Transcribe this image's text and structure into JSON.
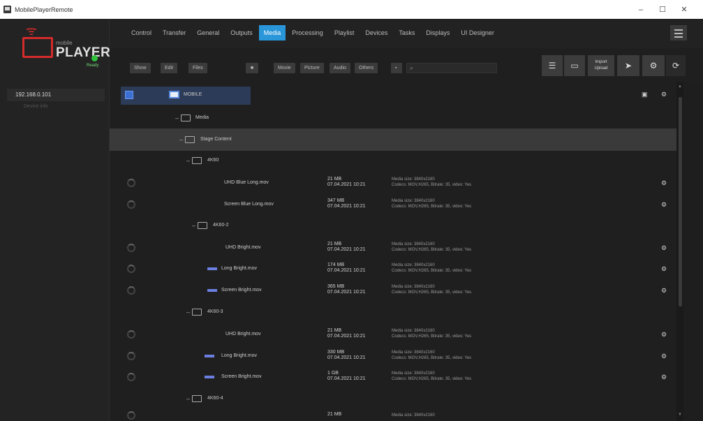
{
  "window": {
    "title": "MobilePlayerRemote",
    "minimize": "–",
    "maximize": "☐",
    "close": "✕"
  },
  "logo": {
    "small_text": "mobile",
    "big_text": "PLAYER"
  },
  "sidebar": {
    "status_label": "Ready",
    "device_ip": "192.168.0.101",
    "device_sub": "Device info"
  },
  "tabs": [
    {
      "label": "Control",
      "active": false
    },
    {
      "label": "Transfer",
      "active": false
    },
    {
      "label": "General",
      "active": false
    },
    {
      "label": "Outputs",
      "active": false
    },
    {
      "label": "Media",
      "active": true
    },
    {
      "label": "Processing",
      "active": false
    },
    {
      "label": "Playlist",
      "active": false
    },
    {
      "label": "Devices",
      "active": false
    },
    {
      "label": "Tasks",
      "active": false
    },
    {
      "label": "Displays",
      "active": false
    },
    {
      "label": "UI Designer",
      "active": false
    }
  ],
  "toolbar": {
    "filters": [
      "Show",
      "Edit",
      "Files"
    ],
    "types": [
      "Movie",
      "Picture",
      "Audio",
      "Others"
    ],
    "search_placeholder": "",
    "import_label": "Import",
    "upload_label": "Upload"
  },
  "tree": {
    "root": "MOBILE",
    "media_folder": "Media",
    "stage_folder": "Stage Content",
    "groups": [
      {
        "folder": "4K60",
        "items": [
          {
            "name": "UHD Blue Long.mov",
            "size": "21 MB",
            "date": "07.04.2021 10:21",
            "meta1": "Media size: 3840x2160",
            "meta2": "Codecs: MOV,H265, Bitrate: 35, video: Yes",
            "thumb": false
          },
          {
            "name": "Screen Blue Long.mov",
            "size": "347 MB",
            "date": "07.04.2021 10:21",
            "meta1": "Media size: 3840x2160",
            "meta2": "Codecs: MOV,H265, Bitrate: 35, video: Yes",
            "thumb": false
          }
        ]
      },
      {
        "folder": "4K60-2",
        "items": [
          {
            "name": "UHD Bright.mov",
            "size": "21 MB",
            "date": "07.04.2021 10:21",
            "meta1": "Media size: 3840x2160",
            "meta2": "Codecs: MOV,H265, Bitrate: 35, video: Yes",
            "thumb": false
          },
          {
            "name": "Long Bright.mov",
            "size": "174 MB",
            "date": "07.04.2021 10:21",
            "meta1": "Media size: 3840x2160",
            "meta2": "Codecs: MOV,H265, Bitrate: 35, video: Yes",
            "thumb": true
          },
          {
            "name": "Screen Bright.mov",
            "size": "365 MB",
            "date": "07.04.2021 10:21",
            "meta1": "Media size: 3840x2160",
            "meta2": "Codecs: MOV,H265, Bitrate: 35, video: Yes",
            "thumb": true
          }
        ]
      },
      {
        "folder": "4K60-3",
        "items": [
          {
            "name": "UHD Bright.mov",
            "size": "21 MB",
            "date": "07.04.2021 10:21",
            "meta1": "Media size: 3840x2160",
            "meta2": "Codecs: MOV,H265, Bitrate: 35, video: Yes",
            "thumb": false
          },
          {
            "name": "Long Bright.mov",
            "size": "330 MB",
            "date": "07.04.2021 10:21",
            "meta1": "Media size: 3840x2160",
            "meta2": "Codecs: MOV,H265, Bitrate: 35, video: Yes",
            "thumb": true
          },
          {
            "name": "Screen Bright.mov",
            "size": "1 GB",
            "date": "07.04.2021 10:21",
            "meta1": "Media size: 3840x2160",
            "meta2": "Codecs: MOV,H265, Bitrate: 35, video: Yes",
            "thumb": true
          }
        ]
      },
      {
        "folder": "4K60-4",
        "items": [
          {
            "name": "",
            "size": "21 MB",
            "date": "",
            "meta1": "Media size: 3840x2160",
            "meta2": "",
            "thumb": false
          }
        ]
      }
    ]
  },
  "colors": {
    "accent": "#2996d9",
    "brand": "#d42b2b",
    "status_ok": "#2fbf3a",
    "highlight_row": "#3a3a3a"
  }
}
